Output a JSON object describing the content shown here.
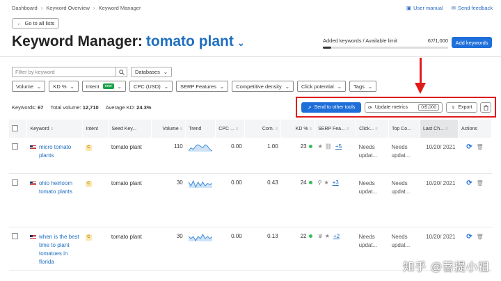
{
  "breadcrumb": [
    "Dashboard",
    "Keyword Overview",
    "Keyword Manager"
  ],
  "top_links": {
    "manual": "User manual",
    "feedback": "Send feedback"
  },
  "back_label": "Go to all lists",
  "title": {
    "prefix": "Keyword Manager:",
    "list_name": "tomato plant"
  },
  "limit": {
    "label": "Added keywords / Available limit",
    "value": "67/1,000",
    "fraction": 0.067
  },
  "add_keywords_label": "Add keywords",
  "filter": {
    "placeholder": "Filter by keyword",
    "databases_label": "Databases"
  },
  "filters": [
    {
      "label": "Volume"
    },
    {
      "label": "KD %"
    },
    {
      "label": "Intent",
      "badge": "new"
    },
    {
      "label": "CPC (USD)"
    },
    {
      "label": "SERP Features"
    },
    {
      "label": "Competitive density"
    },
    {
      "label": "Click potential"
    },
    {
      "label": "Tags"
    }
  ],
  "stats": {
    "keywords_label": "Keywords:",
    "keywords": "67",
    "volume_label": "Total volume:",
    "volume": "12,710",
    "kd_label": "Average KD:",
    "kd": "24.3%"
  },
  "actions": {
    "send": "Send to other tools",
    "update": "Update metrics",
    "update_count": "0/5,000",
    "export": "Export"
  },
  "columns": [
    "Keyword",
    "Intent",
    "Seed Key...",
    "Volume",
    "Trend",
    "CPC ...",
    "Com.",
    "KD %",
    "SERP Fea...",
    "Click...",
    "Top Co...",
    "Last Ch...",
    "Actions"
  ],
  "rows": [
    {
      "keyword": "micro tomato plants",
      "intent": "C",
      "seed": "tomato plant",
      "volume": "110",
      "cpc": "0.00",
      "com": "1.00",
      "kd": "23",
      "serp_more": "+5",
      "click": "Needs updat...",
      "top": "Needs updat...",
      "last": "10/20/ 2021",
      "trend": [
        3,
        5,
        4,
        6,
        7,
        6,
        5,
        7,
        6,
        4,
        3
      ]
    },
    {
      "keyword": "ohio heirloom tomato plants",
      "intent": "C",
      "seed": "tomato plant",
      "volume": "30",
      "cpc": "0.00",
      "com": "0.43",
      "kd": "24",
      "serp_more": "+3",
      "click": "Needs updat...",
      "top": "Needs updat...",
      "last": "10/20/ 2021",
      "trend": [
        6,
        3,
        7,
        2,
        6,
        3,
        6,
        3,
        5,
        4,
        5
      ]
    },
    {
      "keyword": "when is the best time to plant tomatoes in florida",
      "intent": "C",
      "seed": "tomato plant",
      "volume": "30",
      "cpc": "0.00",
      "com": "0.13",
      "kd": "22",
      "serp_more": "+2",
      "click": "Needs updat...",
      "top": "Needs updat...",
      "last": "10/20/ 2021",
      "trend": [
        5,
        4,
        5,
        3,
        5,
        4,
        6,
        4,
        5,
        4,
        5
      ]
    }
  ],
  "watermark": "知乎 @菩提小祖",
  "colors": {
    "accent": "#1f6fdb",
    "highlight": "#e01b1b",
    "kd_dot": "#2fbf5a"
  }
}
